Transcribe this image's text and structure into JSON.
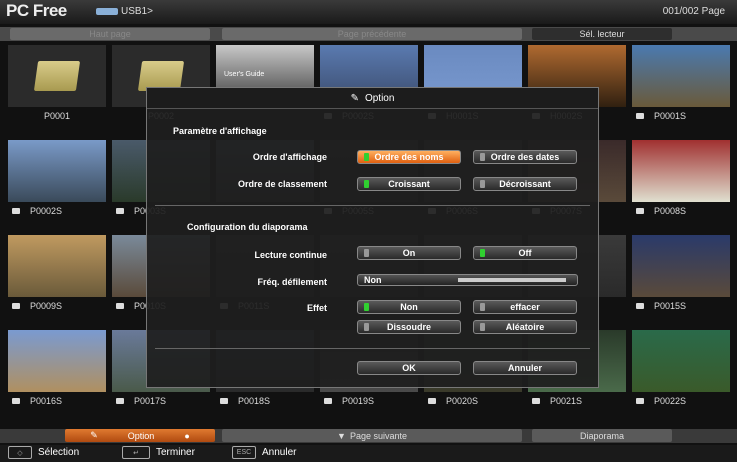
{
  "header": {
    "title": "PC Free",
    "source": "USB1>",
    "page_count": "001/002 Page"
  },
  "toolbar": {
    "prev": "Haut page",
    "up": "Page précédente",
    "reader": "Sél. lecteur"
  },
  "thumbnails": [
    {
      "label": "P0001",
      "type": "folder"
    },
    {
      "label": "P0002",
      "type": "folder"
    },
    {
      "label": "",
      "type": "doc",
      "caption": "User's Guide"
    },
    {
      "label": "P0002S",
      "type": "photo"
    },
    {
      "label": "H0001S",
      "type": "photo"
    },
    {
      "label": "H0002S",
      "type": "photo"
    },
    {
      "label": "P0001S",
      "type": "photo"
    },
    {
      "label": "P0002S",
      "type": "photo"
    },
    {
      "label": "P0003S",
      "type": "photo"
    },
    {
      "label": "",
      "type": "photo"
    },
    {
      "label": "P0005S",
      "type": "photo"
    },
    {
      "label": "P0006S",
      "type": "photo"
    },
    {
      "label": "P0007S",
      "type": "photo"
    },
    {
      "label": "P0008S",
      "type": "photo"
    },
    {
      "label": "P0009S",
      "type": "photo"
    },
    {
      "label": "P0010S",
      "type": "photo"
    },
    {
      "label": "P0011S",
      "type": "photo"
    },
    {
      "label": "",
      "type": "photo"
    },
    {
      "label": "",
      "type": "photo"
    },
    {
      "label": "",
      "type": "photo"
    },
    {
      "label": "P0015S",
      "type": "photo"
    },
    {
      "label": "P0016S",
      "type": "photo"
    },
    {
      "label": "P0017S",
      "type": "photo"
    },
    {
      "label": "P0018S",
      "type": "photo"
    },
    {
      "label": "P0019S",
      "type": "photo"
    },
    {
      "label": "P0020S",
      "type": "photo"
    },
    {
      "label": "P0021S",
      "type": "photo"
    },
    {
      "label": "P0022S",
      "type": "photo"
    }
  ],
  "dialog": {
    "title": "Option",
    "section1": "Paramètre d'affichage",
    "ordre_affichage_label": "Ordre d'affichage",
    "ordre_noms": "Ordre des noms",
    "ordre_dates": "Ordre des dates",
    "ordre_classement_label": "Ordre de classement",
    "croissant": "Croissant",
    "decroissant": "Décroissant",
    "section2": "Configuration du diaporama",
    "lecture_label": "Lecture continue",
    "on": "On",
    "off": "Off",
    "freq_label": "Fréq. défilement",
    "freq_value": "Non",
    "effet_label": "Effet",
    "effet_non": "Non",
    "effacer": "effacer",
    "dissoudre": "Dissoudre",
    "aleatoire": "Aléatoire",
    "ok": "OK",
    "annuler": "Annuler"
  },
  "bottom": {
    "option": "Option",
    "next": "Page suivante",
    "diaporama": "Diaporama"
  },
  "help": {
    "selection": "Sélection",
    "terminer": "Terminer",
    "annuler": "Annuler",
    "esc": "ESC"
  },
  "colors": {
    "accent": "#e06010",
    "selected_indicator": "#30d030"
  }
}
